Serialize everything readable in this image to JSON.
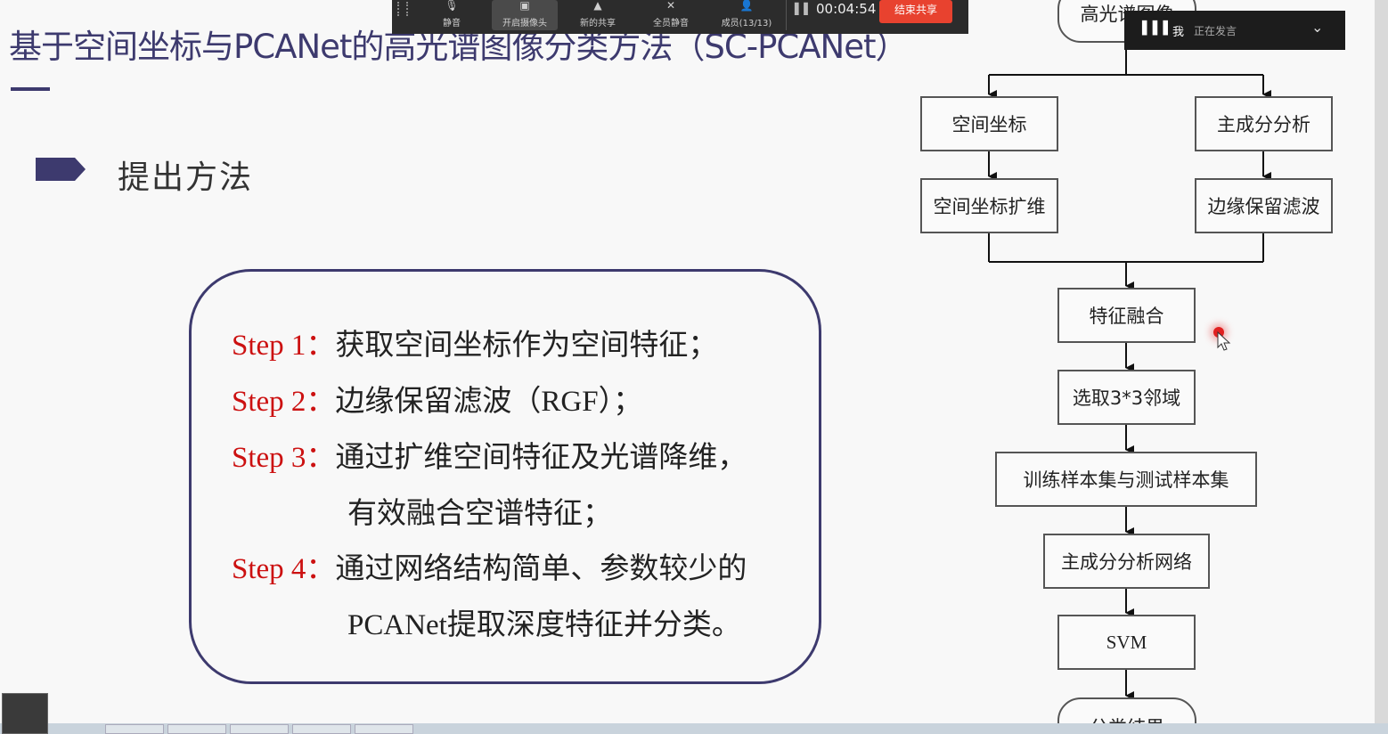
{
  "slide": {
    "title": "基于空间坐标与PCANet的高光谱图像分类方法（SC-PCANet）",
    "section_heading": "提出方法",
    "steps": [
      {
        "label": "Step 1：",
        "text": "获取空间坐标作为空间特征；"
      },
      {
        "label": "Step 2：",
        "text": "边缘保留滤波（RGF）；"
      },
      {
        "label": "Step 3：",
        "text": "通过扩维空间特征及光谱降维，",
        "continuation": "有效融合空谱特征；"
      },
      {
        "label": "Step 4：",
        "text": "通过网络结构简单、参数较少的",
        "continuation": "PCANet提取深度特征并分类。"
      }
    ]
  },
  "flowchart": {
    "start": "高光谱图像",
    "left_branch": [
      "空间坐标",
      "空间坐标扩维"
    ],
    "right_branch": [
      "主成分分析",
      "边缘保留滤波"
    ],
    "chain": [
      "特征融合",
      "选取3*3邻域",
      "训练样本集与测试样本集",
      "主成分分析网络",
      "SVM"
    ],
    "end": "分类结果"
  },
  "meeting_toolbar": {
    "items": [
      {
        "icon": "microphone-icon",
        "label": "静音"
      },
      {
        "icon": "camera-icon",
        "label": "开启摄像头"
      },
      {
        "icon": "share-icon",
        "label": "新的共享"
      },
      {
        "icon": "mute-all-icon",
        "label": "全员静音"
      },
      {
        "icon": "members-icon",
        "label": "成员(13/13)"
      }
    ],
    "timer": "00:04:54",
    "end_share_label": "结束共享",
    "end_share_color": "#e8422f"
  },
  "speaker_panel": {
    "name": "我",
    "status": "正在发言"
  },
  "colors": {
    "title": "#3d3a6e",
    "step_label": "#cc1111"
  }
}
